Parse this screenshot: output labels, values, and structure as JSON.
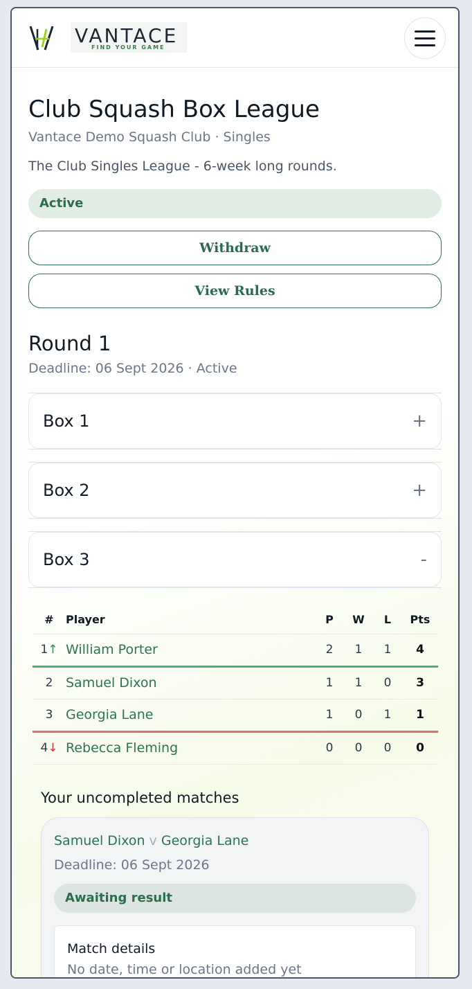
{
  "brand": {
    "name": "VANTACE",
    "tagline": "FIND YOUR GAME",
    "accent": "#2d7450"
  },
  "header": {
    "menu_icon": "hamburger-icon"
  },
  "league": {
    "title": "Club Squash Box League",
    "subtitle": "Vantace Demo Squash Club · Singles",
    "description": "The Club Singles League - 6-week long rounds.",
    "status": "Active",
    "withdraw_label": "Withdraw",
    "rules_label": "View Rules"
  },
  "round": {
    "title": "Round 1",
    "meta": "Deadline: 06 Sept 2026 · Active",
    "boxes": [
      {
        "label": "Box 1",
        "toggle": "+"
      },
      {
        "label": "Box 2",
        "toggle": "+"
      },
      {
        "label": "Box 3",
        "toggle": "-"
      }
    ]
  },
  "standings": {
    "headers": {
      "rank": "#",
      "player": "Player",
      "played": "P",
      "won": "W",
      "lost": "L",
      "points": "Pts"
    },
    "rows": [
      {
        "rank": "1",
        "move": "↑",
        "player": "William Porter",
        "played": "2",
        "won": "1",
        "lost": "1",
        "points": "4"
      },
      {
        "rank": "2",
        "move": "",
        "player": "Samuel Dixon",
        "played": "1",
        "won": "1",
        "lost": "0",
        "points": "3"
      },
      {
        "rank": "3",
        "move": "",
        "player": "Georgia Lane",
        "played": "1",
        "won": "0",
        "lost": "1",
        "points": "1"
      },
      {
        "rank": "4",
        "move": "↓",
        "player": "Rebecca Fleming",
        "played": "0",
        "won": "0",
        "lost": "0",
        "points": "0"
      }
    ]
  },
  "uncompleted": {
    "title": "Your uncompleted matches",
    "match": {
      "player1": "Samuel Dixon",
      "versus": "v",
      "player2": "Georgia Lane",
      "deadline": "Deadline: 06 Sept 2026",
      "status": "Awaiting result",
      "details_title": "Match details",
      "details_sub": "No date, time or location added yet"
    }
  }
}
